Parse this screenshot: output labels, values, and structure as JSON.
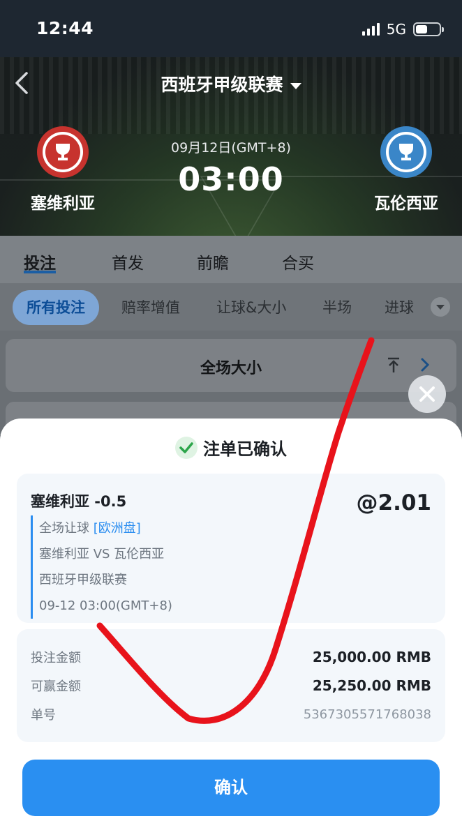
{
  "status_bar": {
    "time": "12:44",
    "network": "5G"
  },
  "header": {
    "league": "西班牙甲级联赛"
  },
  "match": {
    "date": "09月12日(GMT+8)",
    "time": "03:00",
    "home_team": "塞维利亚",
    "away_team": "瓦伦西亚",
    "home_crest_color": "#c7332e",
    "away_crest_color": "#3a86c8"
  },
  "tabs": [
    "投注",
    "首发",
    "前瞻",
    "合买"
  ],
  "filters": [
    "所有投注",
    "赔率增值",
    "让球&大小",
    "半场",
    "进球"
  ],
  "market": {
    "title": "全场大小"
  },
  "confirmation": {
    "title": "注单已确认",
    "selection": "塞维利亚 -0.5",
    "odds": "@2.01",
    "market": "全场让球",
    "market_type": "[欧洲盘]",
    "matchup": "塞维利亚 VS 瓦伦西亚",
    "league": "西班牙甲级联赛",
    "datetime": "09-12 03:00(GMT+8)",
    "stake_label": "投注金额",
    "stake_value": "25,000.00 RMB",
    "win_label": "可赢金额",
    "win_value": "25,250.00 RMB",
    "ticket_label": "单号",
    "ticket_value": "5367305571768038",
    "confirm_label": "确认"
  },
  "colors": {
    "accent": "#2a8ff1",
    "annotation": "#e8131b",
    "success": "#2ca54a"
  }
}
